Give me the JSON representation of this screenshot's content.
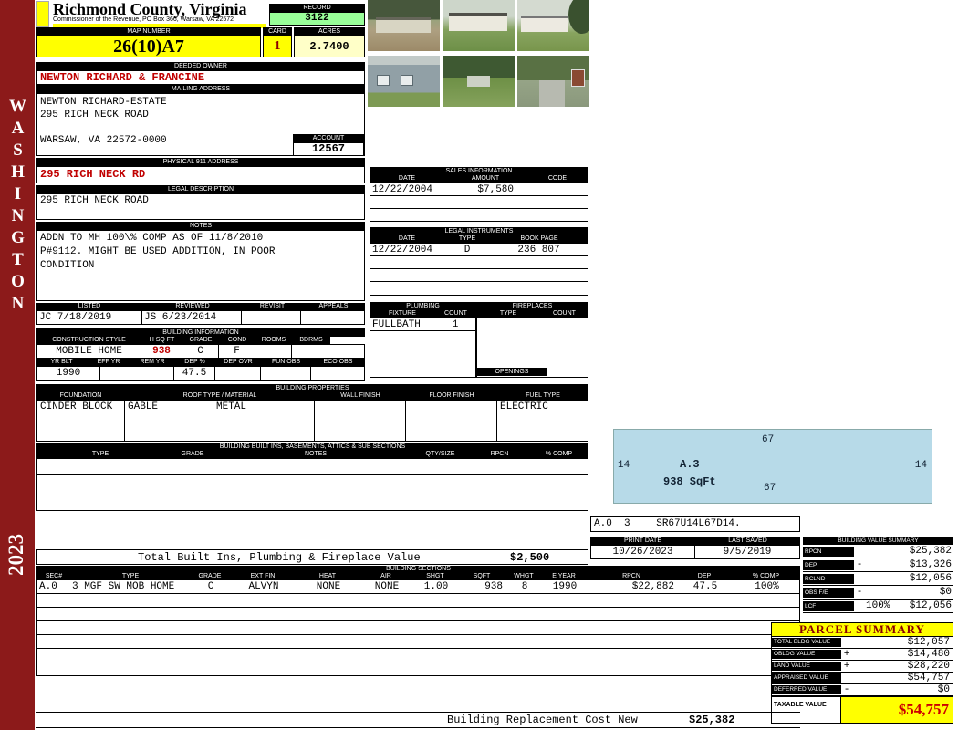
{
  "colors": {
    "sidebar_maroon": "#8C1A1A",
    "highlight_yellow": "#FFFF00",
    "record_green": "#99FF99",
    "acres_cream": "#FFFFC8",
    "accent_red": "#C00000",
    "sketch_blue": "#B7DAE8"
  },
  "sidebar": {
    "watermark": "WASHINGTON",
    "year": "2023"
  },
  "header": {
    "county": "Richmond County, Virginia",
    "commissioner_line": "Commissioner of the Revenue, PO Box 366, Warsaw, VA 22572",
    "record": {
      "label": "RECORD",
      "value": "3122"
    },
    "map_number": {
      "label": "MAP NUMBER",
      "value": "26(10)A7"
    },
    "card": {
      "label": "CARD",
      "value": "1"
    },
    "acres": {
      "label": "ACRES",
      "value": "2.7400"
    }
  },
  "owner": {
    "deeded_owner": {
      "label": "DEEDED OWNER",
      "value": "NEWTON RICHARD & FRANCINE"
    },
    "mailing": {
      "label": "MAILING ADDRESS",
      "line1": "NEWTON RICHARD-ESTATE",
      "line2": "295 RICH NECK ROAD",
      "line3": "WARSAW, VA 22572-0000"
    },
    "account": {
      "label": "ACCOUNT",
      "value": "12567"
    },
    "physical_911": {
      "label": "PHYSICAL 911 ADDRESS",
      "value": "295 RICH NECK RD"
    },
    "legal_description": {
      "label": "LEGAL DESCRIPTION",
      "value": "295 RICH NECK ROAD"
    },
    "notes": {
      "label": "NOTES",
      "line1": "ADDN TO MH 100\\% COMP AS OF 11/8/2010",
      "line2": "P#9112. MIGHT BE USED ADDITION, IN POOR",
      "line3": "CONDITION"
    }
  },
  "review": {
    "listed": {
      "label": "LISTED",
      "value": "JC  7/18/2019"
    },
    "reviewed": {
      "label": "REVIEWED",
      "value": "JS  6/23/2014"
    },
    "revisit": {
      "label": "REVISIT",
      "value": ""
    },
    "appeals": {
      "label": "APPEALS",
      "value": ""
    }
  },
  "building_information": {
    "title": "BUILDING INFORMATION",
    "construction_style": {
      "label": "CONSTRUCTION STYLE",
      "value": "MOBILE HOME"
    },
    "h_sq_ft": {
      "label": "H SQ FT",
      "value": "938"
    },
    "grade": {
      "label": "GRADE",
      "value": "C"
    },
    "cond": {
      "label": "COND",
      "value": "F"
    },
    "rooms": {
      "label": "ROOMS",
      "value": ""
    },
    "bdrms": {
      "label": "BDRMS",
      "value": ""
    },
    "yr_blt": {
      "label": "YR BLT",
      "value": "1990"
    },
    "eff_yr": {
      "label": "EFF YR",
      "value": ""
    },
    "rem_yr": {
      "label": "REM YR",
      "value": ""
    },
    "dep_pct": {
      "label": "DEP %",
      "value": "47.5"
    },
    "dep_ovr": {
      "label": "DEP OVR",
      "value": ""
    },
    "fun_obs": {
      "label": "FUN OBS",
      "value": ""
    },
    "eco_obs": {
      "label": "ECO OBS",
      "value": ""
    }
  },
  "building_properties": {
    "title": "BUILDING PROPERTIES",
    "foundation": {
      "label": "FOUNDATION",
      "value": "CINDER BLOCK"
    },
    "roof": {
      "label": "ROOF TYPE / MATERIAL",
      "type": "GABLE",
      "material": "METAL"
    },
    "wall_finish": {
      "label": "WALL FINISH",
      "value": ""
    },
    "floor_finish": {
      "label": "FLOOR FINISH",
      "value": ""
    },
    "fuel_type": {
      "label": "FUEL TYPE",
      "value": "ELECTRIC"
    }
  },
  "built_ins": {
    "title": "BUILDING BUILT INS, BASEMENTS, ATTICS & SUB SECTIONS",
    "headers": [
      "TYPE",
      "GRADE",
      "NOTES",
      "QTY/SIZE",
      "RPCN",
      "% COMP"
    ]
  },
  "sales_information": {
    "title": "SALES INFORMATION",
    "headers": {
      "date": "DATE",
      "amount": "AMOUNT",
      "code": "CODE"
    },
    "rows": [
      {
        "date": "12/22/2004",
        "amount": "$7,580",
        "code": ""
      }
    ]
  },
  "legal_instruments": {
    "title": "LEGAL INSTRUMENTS",
    "headers": {
      "date": "DATE",
      "type": "TYPE",
      "book_page": "BOOK PAGE"
    },
    "rows": [
      {
        "date": "12/22/2004",
        "type": "D",
        "book_page": "236 807"
      }
    ]
  },
  "plumbing": {
    "title": "PLUMBING",
    "headers": {
      "fixture": "FIXTURE",
      "count": "COUNT"
    },
    "rows": [
      {
        "fixture": "FULLBATH",
        "count": "1"
      }
    ]
  },
  "fireplaces": {
    "title": "FIREPLACES",
    "headers": {
      "type": "TYPE",
      "count": "COUNT"
    },
    "openings_label": "OPENINGS"
  },
  "sketch": {
    "dim_top": "67",
    "dim_left": "14",
    "dim_right": "14",
    "dim_bottom": "67",
    "section_label": "A.3",
    "section_sqft": "938 SqFt",
    "code_prefix": "A.0  3",
    "code": "SR67U14L67D14."
  },
  "print_info": {
    "print_date": {
      "label": "PRINT DATE",
      "value": "10/26/2023"
    },
    "last_saved": {
      "label": "LAST SAVED",
      "value": "9/5/2019"
    }
  },
  "building_value_summary": {
    "title": "BUILDING VALUE SUMMARY",
    "rows": [
      {
        "label": "RPCN",
        "op": "",
        "value": "$25,382"
      },
      {
        "label": "DEP",
        "op": "-",
        "value": "$13,326"
      },
      {
        "label": "RCLND",
        "op": "",
        "value": "$12,056"
      },
      {
        "label": "OBS F/E",
        "op": "-",
        "value": "$0"
      },
      {
        "label": "LCF",
        "extra": "100%",
        "op": "",
        "value": "$12,056"
      }
    ]
  },
  "totals": {
    "built_ins_line": {
      "label": "Total Built Ins, Plumbing & Fireplace Value",
      "value": "$2,500"
    },
    "replacement_cost": {
      "label": "Building Replacement Cost New",
      "value": "$25,382"
    }
  },
  "building_sections": {
    "title": "BUILDING SECTIONS",
    "headers": [
      "SEC#",
      "TYPE",
      "GRADE",
      "EXT FIN",
      "HEAT",
      "AIR",
      "SHGT",
      "SQFT",
      "WHGT",
      "E YEAR",
      "RPCN",
      "DEP",
      "% COMP"
    ],
    "rows": [
      {
        "sec": "A.0",
        "type": "3 MGF SW MOB HOME",
        "grade": "C",
        "ext_fin": "ALVYN",
        "heat": "NONE",
        "air": "NONE",
        "shgt": "1.00",
        "sqft": "938",
        "whgt": "8",
        "e_year": "1990",
        "rpcn": "$22,882",
        "dep": "47.5",
        "pct_comp": "100%"
      }
    ]
  },
  "parcel_summary": {
    "title": "PARCEL SUMMARY",
    "rows": [
      {
        "label": "TOTAL BLDG VALUE",
        "op": "",
        "value": "$12,057"
      },
      {
        "label": "OBLDG VALUE",
        "op": "+",
        "value": "$14,480"
      },
      {
        "label": "LAND VALUE",
        "op": "+",
        "value": "$28,220"
      },
      {
        "label": "APPRAISED VALUE",
        "op": "",
        "value": "$54,757"
      },
      {
        "label": "DEFERRED VALUE",
        "op": "-",
        "value": "$0"
      }
    ],
    "taxable": {
      "label": "TAXABLE VALUE",
      "value": "$54,757"
    }
  }
}
